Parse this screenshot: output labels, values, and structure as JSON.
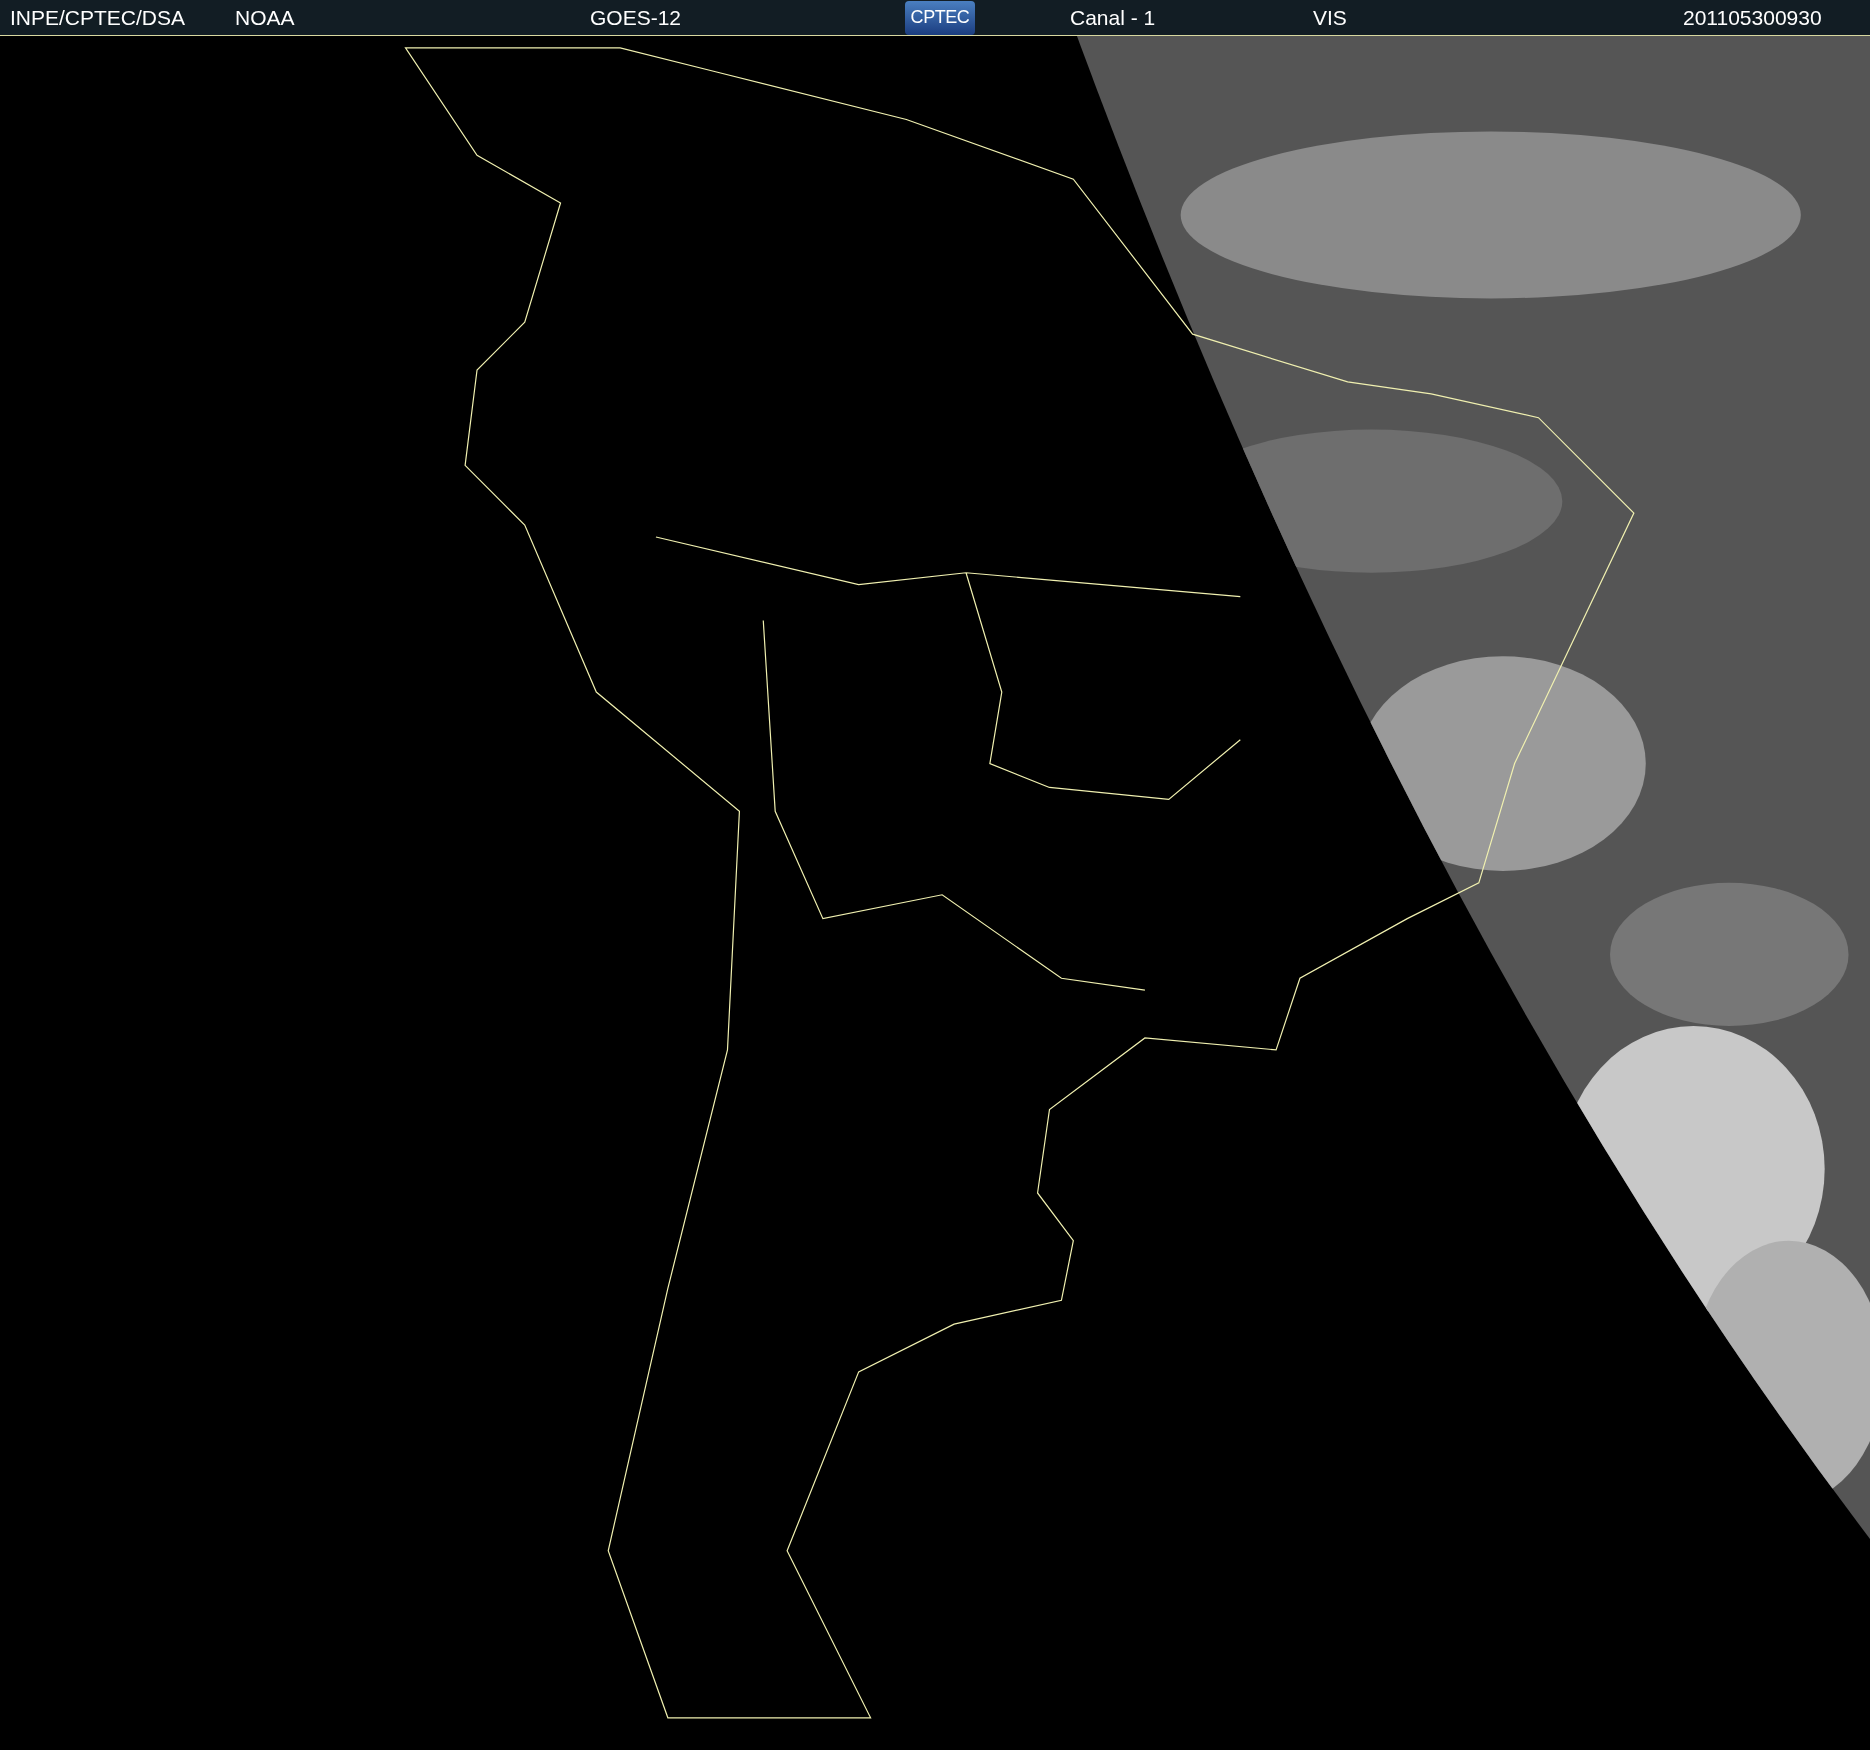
{
  "header": {
    "source": "INPE/CPTEC/DSA",
    "agency": "NOAA",
    "satellite": "GOES-12",
    "logo": "CPTEC",
    "channel": "Canal - 1",
    "band": "VIS",
    "timestamp": "201105300930"
  }
}
